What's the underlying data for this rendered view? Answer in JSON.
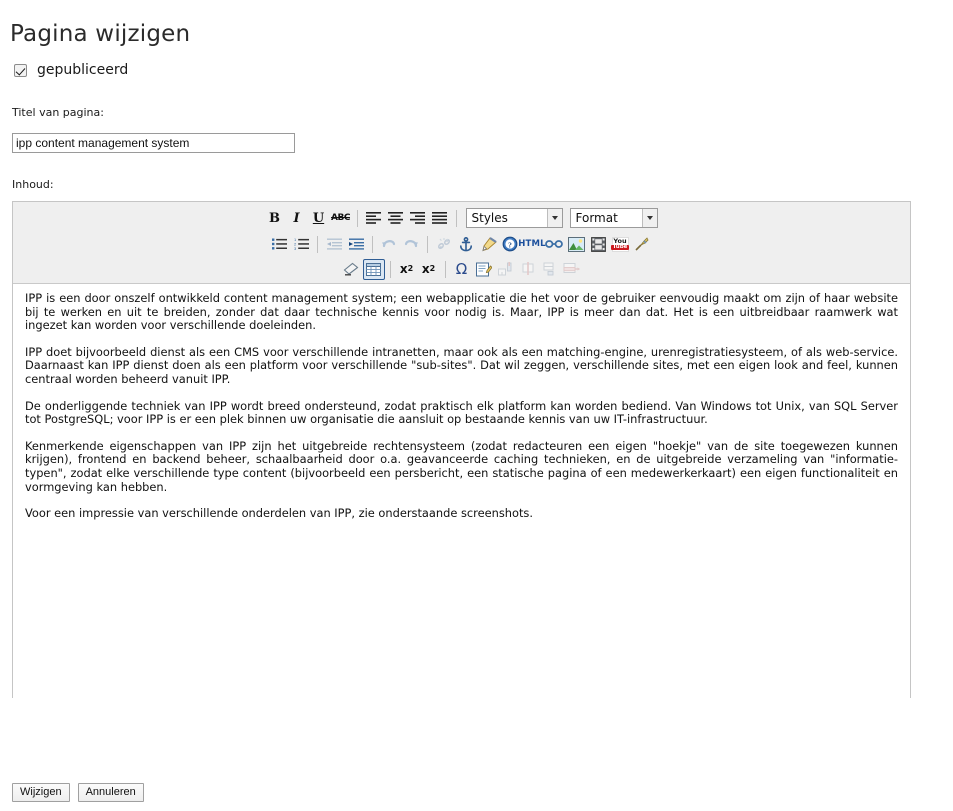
{
  "page": {
    "title": "Pagina wijzigen"
  },
  "published": {
    "label": "gepubliceerd",
    "checked": true
  },
  "form": {
    "title_label": "Titel van pagina:",
    "title_value": "ipp content management system",
    "title_placeholder": "",
    "content_label": "Inhoud:"
  },
  "editor": {
    "styles_select": {
      "value": "Styles",
      "options": [
        "Styles"
      ]
    },
    "format_select": {
      "value": "Format",
      "options": [
        "Format"
      ]
    },
    "toolbar_row1": [
      {
        "name": "bold-button",
        "label": "B",
        "title": "Bold",
        "state": "normal"
      },
      {
        "name": "italic-button",
        "label": "I",
        "title": "Italic",
        "state": "normal"
      },
      {
        "name": "underline-button",
        "label": "U",
        "title": "Underline",
        "state": "normal"
      },
      {
        "name": "strikethrough-button",
        "label": "ABC",
        "title": "Strike Through",
        "state": "normal"
      },
      {
        "name": "align-left-button",
        "label": "",
        "title": "Align Left",
        "state": "normal"
      },
      {
        "name": "align-center-button",
        "label": "",
        "title": "Center",
        "state": "normal"
      },
      {
        "name": "align-right-button",
        "label": "",
        "title": "Align Right",
        "state": "normal"
      },
      {
        "name": "align-justify-button",
        "label": "",
        "title": "Justify",
        "state": "normal"
      }
    ],
    "toolbar_row2": [
      {
        "name": "bulleted-list-button",
        "title": "Insert/Remove Bulleted List",
        "state": "normal"
      },
      {
        "name": "numbered-list-button",
        "title": "Insert/Remove Numbered List",
        "state": "normal"
      },
      {
        "name": "decrease-indent-button",
        "title": "Decrease Indent",
        "state": "disabled"
      },
      {
        "name": "increase-indent-button",
        "title": "Increase Indent",
        "state": "normal"
      },
      {
        "name": "undo-button",
        "title": "Undo",
        "state": "disabled"
      },
      {
        "name": "redo-button",
        "title": "Redo",
        "state": "disabled"
      },
      {
        "name": "unlink-button",
        "title": "Unlink",
        "state": "disabled"
      },
      {
        "name": "anchor-button",
        "title": "Anchor",
        "state": "normal"
      },
      {
        "name": "remove-format-button",
        "title": "Remove Format",
        "state": "normal"
      },
      {
        "name": "about-button",
        "title": "About CKEditor",
        "state": "normal"
      },
      {
        "name": "source-html-button",
        "label": "HTML",
        "title": "Source",
        "state": "normal"
      },
      {
        "name": "link-button",
        "title": "Link",
        "state": "normal"
      },
      {
        "name": "image-button",
        "title": "Image",
        "state": "normal"
      },
      {
        "name": "flash-video-button",
        "title": "Flash",
        "state": "normal"
      },
      {
        "name": "youtube-button",
        "label_top": "You",
        "label_bottom": "Tube",
        "title": "YouTube",
        "state": "normal"
      },
      {
        "name": "maximize-button",
        "title": "Maximize",
        "state": "normal"
      }
    ],
    "toolbar_row3": [
      {
        "name": "eraser-button",
        "title": "Remove Format",
        "state": "normal"
      },
      {
        "name": "table-button",
        "title": "Table",
        "state": "selected"
      },
      {
        "name": "subscript-button",
        "label": "x2",
        "title": "Subscript",
        "state": "normal"
      },
      {
        "name": "superscript-button",
        "label": "x2",
        "title": "Superscript",
        "state": "normal"
      },
      {
        "name": "special-character-button",
        "label": "Ω",
        "title": "Insert Special Character",
        "state": "normal"
      },
      {
        "name": "edit-form-button",
        "title": "Templates",
        "state": "normal"
      },
      {
        "name": "insert-column-button",
        "title": "Insert Column",
        "state": "disabled"
      },
      {
        "name": "insert-cell-button",
        "title": "Insert Cell",
        "state": "disabled"
      },
      {
        "name": "insert-row-button",
        "title": "Insert Row",
        "state": "disabled"
      },
      {
        "name": "merge-cells-button",
        "title": "Merge Cells",
        "state": "disabled"
      }
    ],
    "content_paragraphs": [
      "IPP is een door onszelf ontwikkeld content management system; een webapplicatie die het voor de gebruiker eenvoudig maakt om zijn of haar website bij te werken en uit te breiden, zonder dat daar technische kennis voor nodig is. Maar, IPP is meer dan dat. Het is een uitbreidbaar raamwerk wat ingezet kan worden voor verschillende doeleinden.",
      "IPP doet bijvoorbeeld dienst als een CMS voor verschillende intranetten, maar ook als een matching-engine, urenregistratiesysteem, of als web-service. Daarnaast kan IPP dienst doen als een platform voor verschillende \"sub-sites\". Dat wil zeggen, verschillende sites, met een eigen look and feel, kunnen centraal worden beheerd vanuit IPP.",
      "De onderliggende techniek van IPP wordt breed ondersteund, zodat praktisch elk platform kan worden bediend. Van Windows tot Unix, van SQL Server tot PostgreSQL; voor IPP is er een plek binnen uw organisatie die aansluit op bestaande kennis van uw IT-infrastructuur.",
      "Kenmerkende eigenschappen van IPP zijn het uitgebreide rechtensysteem (zodat redacteuren een eigen \"hoekje\" van de site toegewezen kunnen krijgen), frontend en backend beheer, schaalbaarheid door o.a. geavanceerde caching technieken, en de uitgebreide verzameling van \"informatie-typen\", zodat elke verschillende type content (bijvoorbeeld een persbericht, een statische pagina of een medewerkerkaart) een eigen functionaliteit en vormgeving kan hebben.",
      "Voor een impressie van verschillende onderdelen van IPP, zie onderstaande screenshots."
    ]
  },
  "actions": {
    "submit_label": "Wijzigen",
    "cancel_label": "Annuleren"
  },
  "colors": {
    "toolbar_bg": "#efefef",
    "editor_border": "#c5c5c5",
    "selected_border": "#2f5d94",
    "accent_blue": "#1b4f9c",
    "youtube_red": "#cc181e"
  }
}
